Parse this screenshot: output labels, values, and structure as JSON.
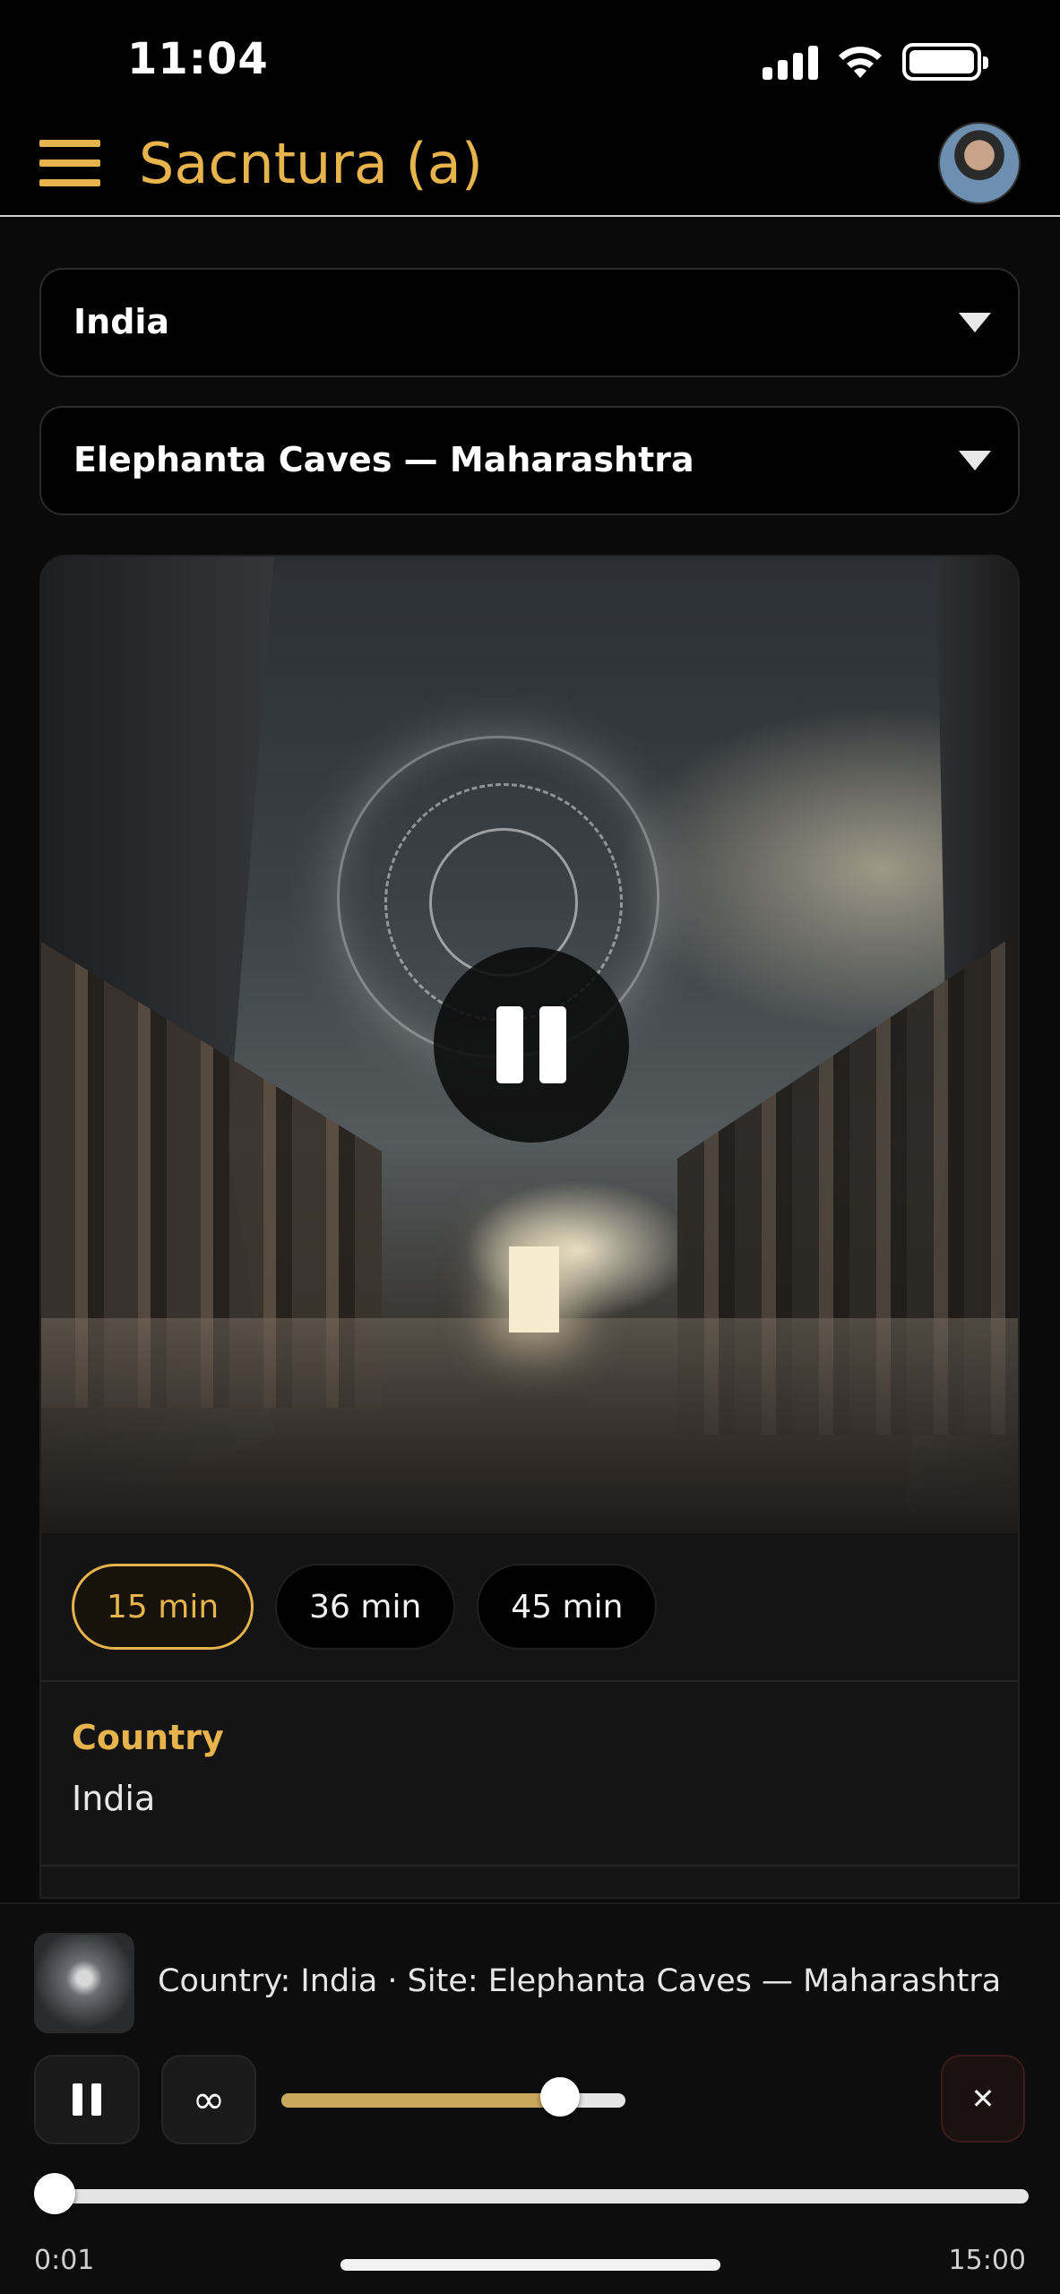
{
  "status_bar": {
    "time": "11:04"
  },
  "header": {
    "title": "Sacntura (a)"
  },
  "dropdowns": {
    "country": {
      "selected": "India"
    },
    "site": {
      "selected": "Elephanta Caves — Maharashtra"
    }
  },
  "durations": [
    {
      "label": "15 min",
      "active": true
    },
    {
      "label": "36 min",
      "active": false
    },
    {
      "label": "45 min",
      "active": false
    }
  ],
  "info": {
    "label": "Country",
    "value": "India"
  },
  "player": {
    "now_playing": "Country: India · Site: Elephanta Caves — Maharashtra",
    "loop_icon_glyph": "∞",
    "close_icon_glyph": "✕",
    "volume_level": 0.81,
    "progress": 0.001,
    "elapsed": "0:01",
    "total": "15:00"
  },
  "colors": {
    "accent": "#e6b34c",
    "background": "#0a0a0a"
  },
  "icons": [
    "menu-icon",
    "chevron-down-icon",
    "pause-icon",
    "loop-icon",
    "close-icon",
    "signal-icon",
    "wifi-icon",
    "battery-icon"
  ]
}
